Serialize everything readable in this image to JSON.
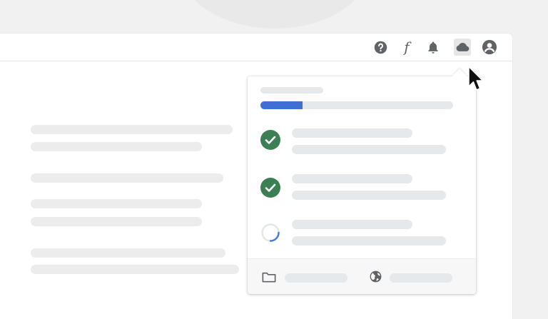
{
  "colors": {
    "progress_fill": "#3d6fd4",
    "success_green": "#3b7f54",
    "pending_blue": "#4a7bd8",
    "icon_gray": "#5f6368"
  },
  "toolbar": {
    "icons": [
      "help-icon",
      "function-icon",
      "bell-icon",
      "cloud-icon",
      "account-icon"
    ],
    "function_glyph": "f"
  },
  "upload_panel": {
    "progress": 0.22,
    "items": [
      {
        "status": "complete",
        "icon": "check-circle-icon"
      },
      {
        "status": "complete",
        "icon": "check-circle-icon"
      },
      {
        "status": "in-progress",
        "icon": "spinner-icon"
      }
    ],
    "footer": {
      "icons": [
        "folder-icon",
        "globe-icon"
      ]
    }
  }
}
